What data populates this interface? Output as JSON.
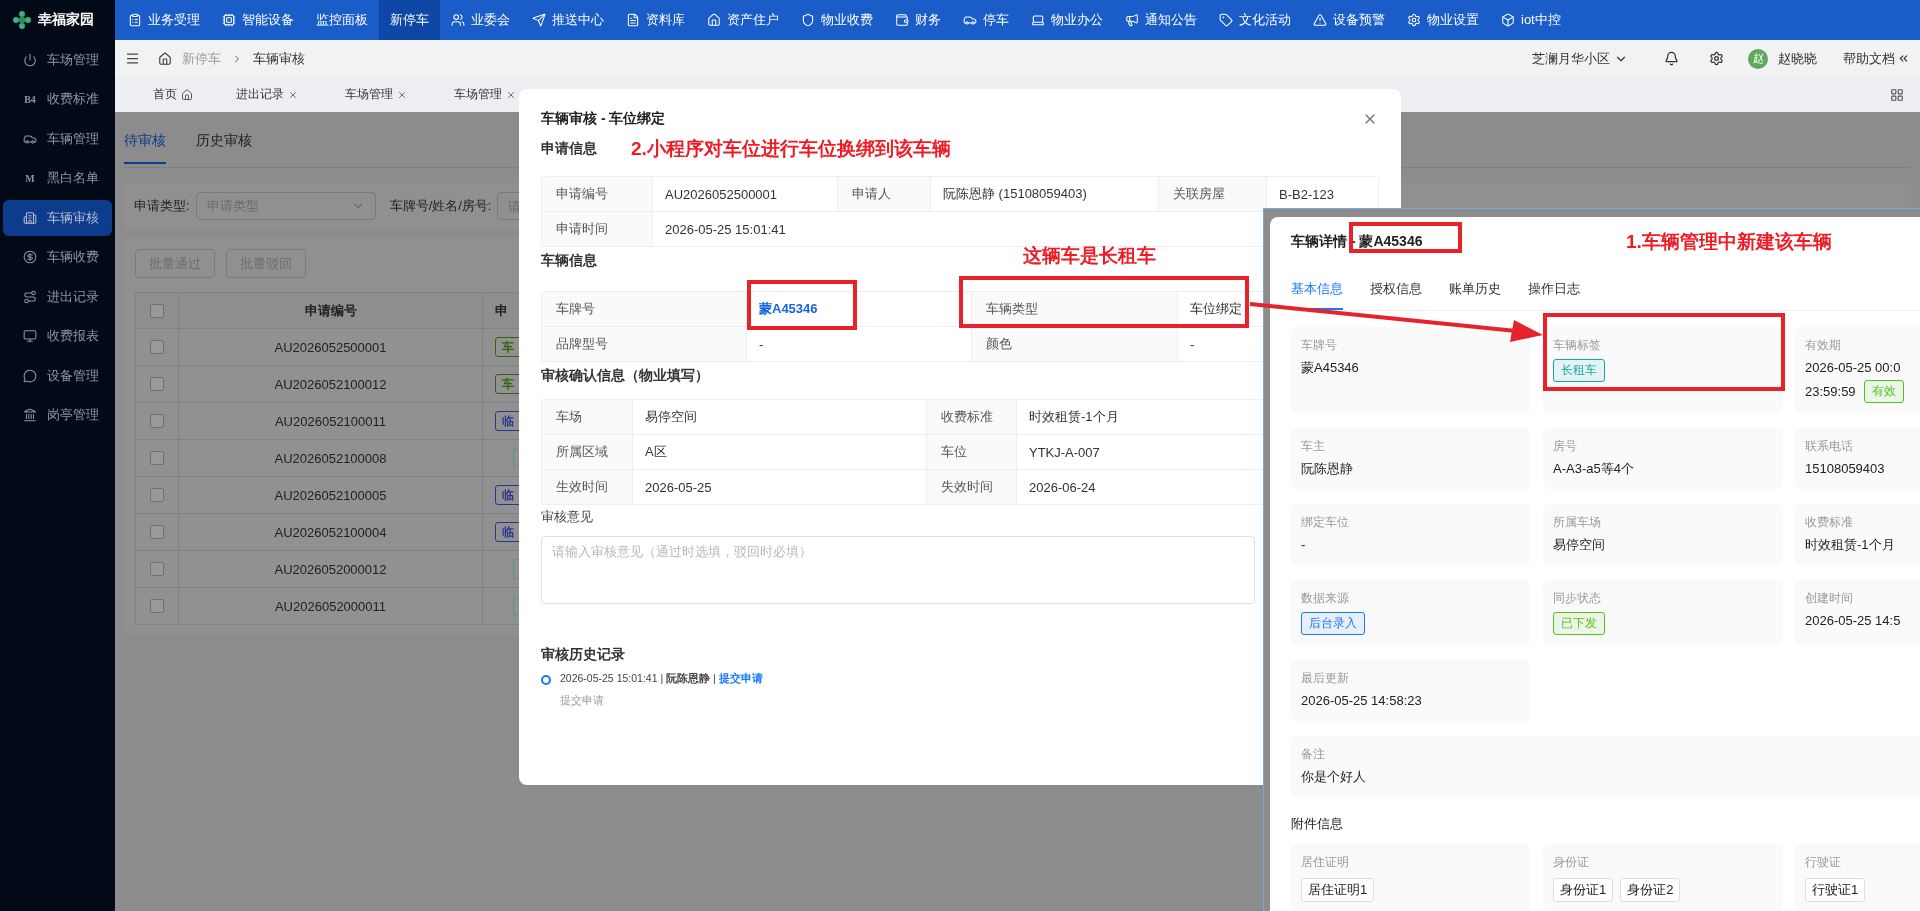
{
  "app": {
    "logo": "幸福家园"
  },
  "top_nav": [
    {
      "label": "业务受理",
      "has_icon": true,
      "selected": false
    },
    {
      "label": "智能设备",
      "has_icon": true,
      "selected": false
    },
    {
      "label": "监控面板",
      "has_icon": false,
      "selected": false
    },
    {
      "label": "新停车",
      "has_icon": false,
      "selected": true
    },
    {
      "label": "业委会",
      "has_icon": true,
      "selected": false
    },
    {
      "label": "推送中心",
      "has_icon": true,
      "selected": false
    },
    {
      "label": "资料库",
      "has_icon": true,
      "selected": false
    },
    {
      "label": "资产住户",
      "has_icon": true,
      "selected": false
    },
    {
      "label": "物业收费",
      "has_icon": true,
      "selected": false
    },
    {
      "label": "财务",
      "has_icon": true,
      "selected": false
    },
    {
      "label": "停车",
      "has_icon": true,
      "selected": false
    },
    {
      "label": "物业办公",
      "has_icon": true,
      "selected": false
    },
    {
      "label": "通知公告",
      "has_icon": true,
      "selected": false
    },
    {
      "label": "文化活动",
      "has_icon": true,
      "selected": false
    },
    {
      "label": "设备预警",
      "has_icon": true,
      "selected": false
    },
    {
      "label": "物业设置",
      "has_icon": true,
      "selected": false
    },
    {
      "label": "iot中控",
      "has_icon": true,
      "selected": false
    }
  ],
  "sidebar": [
    {
      "label": "车场管理",
      "selected": false
    },
    {
      "label": "收费标准",
      "glyph": "B4",
      "selected": false
    },
    {
      "label": "车辆管理",
      "selected": false
    },
    {
      "label": "黑白名单",
      "glyph": "M",
      "selected": false
    },
    {
      "label": "车辆审核",
      "selected": true
    },
    {
      "label": "车辆收费",
      "selected": false
    },
    {
      "label": "进出记录",
      "selected": false
    },
    {
      "label": "收费报表",
      "selected": false
    },
    {
      "label": "设备管理",
      "selected": false
    },
    {
      "label": "岗亭管理",
      "selected": false
    }
  ],
  "header": {
    "breadcrumb": [
      "新停车",
      "车辆审核"
    ],
    "community": "芝澜月华小区",
    "avatar_initial": "赵",
    "user": "赵晓晓",
    "help": "帮助文档"
  },
  "page_tabs": [
    {
      "label": "首页",
      "kind": "home"
    },
    {
      "label": "进出记录",
      "kind": "closable"
    },
    {
      "label": "车场管理",
      "kind": "closable"
    },
    {
      "label": "车场管理",
      "kind": "closable"
    }
  ],
  "content": {
    "tabs": [
      {
        "label": "待审核",
        "selected": true
      },
      {
        "label": "历史审核",
        "selected": false
      }
    ],
    "filters": [
      {
        "label": "申请类型:",
        "kind": "select",
        "placeholder": "申请类型"
      },
      {
        "label": "车牌号/姓名/房号:",
        "kind": "input",
        "placeholder": "请"
      }
    ],
    "actions": [
      {
        "label": "批量通过",
        "disabled": true
      },
      {
        "label": "批量驳回",
        "disabled": true
      }
    ],
    "table": {
      "select_all": false,
      "columns": [
        "申请编号",
        "申"
      ],
      "rows": [
        {
          "checked": false,
          "id": "AU2026052500001",
          "tag": {
            "text": "车",
            "color": "#2f6410"
          }
        },
        {
          "checked": false,
          "id": "AU2026052100012",
          "tag": {
            "text": "车",
            "color": "#2f6410"
          }
        },
        {
          "checked": false,
          "id": "AU2026052100011",
          "tag": {
            "text": "临",
            "color": "#2a3590"
          }
        },
        {
          "checked": false,
          "id": "AU2026052100008",
          "tag": {
            "color": "#4f9a8c"
          }
        },
        {
          "checked": false,
          "id": "AU2026052100005",
          "tag": {
            "text": "临",
            "color": "#2a3590"
          }
        },
        {
          "checked": false,
          "id": "AU2026052100004",
          "tag": {
            "text": "临",
            "color": "#2a3590"
          }
        },
        {
          "checked": false,
          "id": "AU2026052000012",
          "tag": {
            "color": "#4f9a8c"
          }
        },
        {
          "checked": false,
          "id": "AU2026052000011",
          "tag": {
            "color": "#4f9a8c"
          }
        }
      ]
    }
  },
  "review_modal": {
    "title": "车辆审核 - 车位绑定",
    "annotation_top": "2.小程序对车位进行车位换绑到该车辆",
    "annotation_type": "这辆车是长租车",
    "sections": [
      {
        "heading": "申请信息",
        "rows": [
          [
            {
              "label": "申请编号",
              "value": "AU2026052500001"
            },
            {
              "label": "申请人",
              "value": "阮陈恩静 (15108059403)"
            },
            {
              "label": "关联房屋",
              "value": "B-B2-123"
            }
          ],
          [
            {
              "label": "申请时间",
              "value": "2026-05-25 15:01:41"
            }
          ]
        ]
      },
      {
        "heading": "车辆信息",
        "rows": [
          [
            {
              "label": "车牌号",
              "value": "蒙A45346",
              "link": true
            },
            {
              "label": "车辆类型",
              "value": "车位绑定"
            }
          ],
          [
            {
              "label": "品牌型号",
              "value": "-"
            },
            {
              "label": "颜色",
              "value": "-"
            }
          ]
        ]
      },
      {
        "heading": "审核确认信息（物业填写）",
        "rows": [
          [
            {
              "label": "车场",
              "value": "易停空间"
            },
            {
              "label": "收费标准",
              "value": "时效租赁-1个月"
            }
          ],
          [
            {
              "label": "所属区域",
              "value": "A区"
            },
            {
              "label": "车位",
              "value": "YTKJ-A-007"
            }
          ],
          [
            {
              "label": "生效时间",
              "value": "2026-05-25"
            },
            {
              "label": "失效时间",
              "value": "2026-06-24"
            }
          ]
        ]
      }
    ],
    "opinion": {
      "label": "审核意见",
      "placeholder": "请输入审核意见（通过时选填，驳回时必填）"
    },
    "history": {
      "heading": "审核历史记录",
      "items": [
        {
          "meta": "2026-05-25 15:01:41 | **阮陈恩静** |",
          "action": "提交申请",
          "note": "提交申请"
        }
      ]
    }
  },
  "detail_panel": {
    "title": "车辆详情 - 蒙A45346",
    "annotation": "1.车辆管理中新建该车辆",
    "tabs": [
      {
        "label": "基本信息",
        "selected": true
      },
      {
        "label": "授权信息",
        "selected": false
      },
      {
        "label": "账单历史",
        "selected": false
      },
      {
        "label": "操作日志",
        "selected": false
      }
    ],
    "fields": [
      {
        "label": "车牌号",
        "lines": [
          "蒙A45346"
        ]
      },
      {
        "label": "车辆标签",
        "tags": [
          {
            "text": "长租车",
            "color": "#13a8a8"
          }
        ]
      },
      {
        "label": "有效期",
        "lines": [
          "2026-05-25 00:0",
          "23:59:59"
        ],
        "tags": [
          {
            "text": "有效",
            "color": "#52c41a"
          }
        ]
      },
      {
        "label": "车主",
        "lines": [
          "阮陈恩静"
        ]
      },
      {
        "label": "房号",
        "lines": [
          "A-A3-a5等4个"
        ]
      },
      {
        "label": "联系电话",
        "lines": [
          "15108059403"
        ]
      },
      {
        "label": "绑定车位",
        "lines": [
          "-"
        ]
      },
      {
        "label": "所属车场",
        "lines": [
          "易停空间"
        ]
      },
      {
        "label": "收费标准",
        "lines": [
          "时效租赁-1个月"
        ]
      },
      {
        "label": "数据来源",
        "tags": [
          {
            "text": "后台录入",
            "color": "#1677ff"
          }
        ]
      },
      {
        "label": "同步状态",
        "tags": [
          {
            "text": "已下发",
            "color": "#52c41a"
          }
        ]
      },
      {
        "label": "创建时间",
        "lines": [
          "2026-05-25 14:5"
        ]
      },
      {
        "label": "最后更新",
        "lines": [
          "2026-05-25 14:58:23"
        ]
      },
      {
        "label": "备注",
        "lines": [
          "你是个好人"
        ],
        "wide": true
      }
    ],
    "attachments": {
      "heading": "附件信息",
      "items": [
        {
          "label": "居住证明",
          "files": [
            "居住证明1"
          ]
        },
        {
          "label": "身份证",
          "files": [
            "身份证1",
            "身份证2"
          ]
        },
        {
          "label": "行驶证",
          "files": [
            "行驶证1"
          ]
        }
      ]
    }
  }
}
